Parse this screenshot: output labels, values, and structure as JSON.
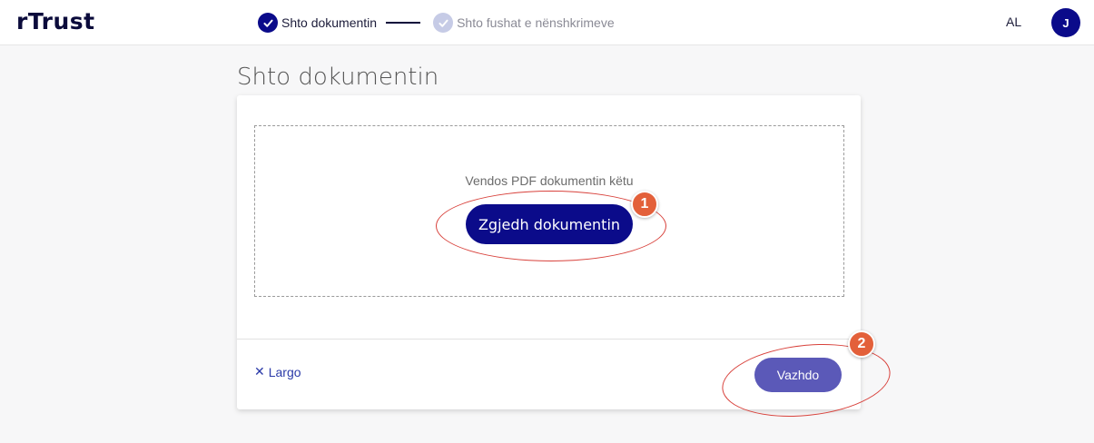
{
  "app": {
    "logo": "rTrust"
  },
  "stepper": {
    "steps": [
      {
        "label": "Shto dokumentin",
        "state": "active"
      },
      {
        "label": "Shto fushat e nënshkrimeve",
        "state": "inactive"
      }
    ]
  },
  "header": {
    "language": "AL",
    "avatar_initial": "J"
  },
  "page": {
    "title": "Shto dokumentin"
  },
  "upload": {
    "hint": "Vendos PDF dokumentin këtu",
    "choose_label": "Zgjedh dokumentin"
  },
  "footer": {
    "cancel_label": "Largo",
    "continue_label": "Vazhdo"
  },
  "annotations": [
    {
      "number": "1"
    },
    {
      "number": "2"
    }
  ],
  "colors": {
    "primary": "#0b0b8a",
    "secondary_button": "#5b59b8",
    "annotation": "#e3603a"
  }
}
